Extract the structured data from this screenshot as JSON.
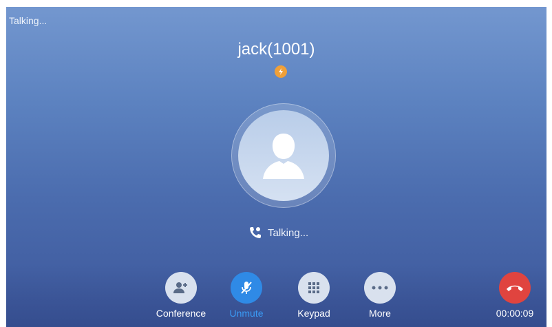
{
  "status_bar": {
    "text": "Talking..."
  },
  "caller": {
    "name": "jack(1001)",
    "badge_icon": "hd-audio-icon",
    "badge_color": "#f0a039"
  },
  "call_state": {
    "text": "Talking...",
    "icon": "phone-talking-icon"
  },
  "controls": [
    {
      "label": "Conference",
      "icon": "add-contact-icon",
      "active": false
    },
    {
      "label": "Unmute",
      "icon": "mic-muted-icon",
      "active": true
    },
    {
      "label": "Keypad",
      "icon": "dialpad-icon",
      "active": false
    },
    {
      "label": "More",
      "icon": "more-dots-icon",
      "active": false
    }
  ],
  "hangup": {
    "icon": "end-call-icon",
    "color": "#e0443f",
    "timer": "00:00:09"
  },
  "colors": {
    "accent": "#2f8ae6",
    "accent_text": "#3a9bf5",
    "background_top": "#7397cf",
    "background_bottom": "#3c569a"
  }
}
